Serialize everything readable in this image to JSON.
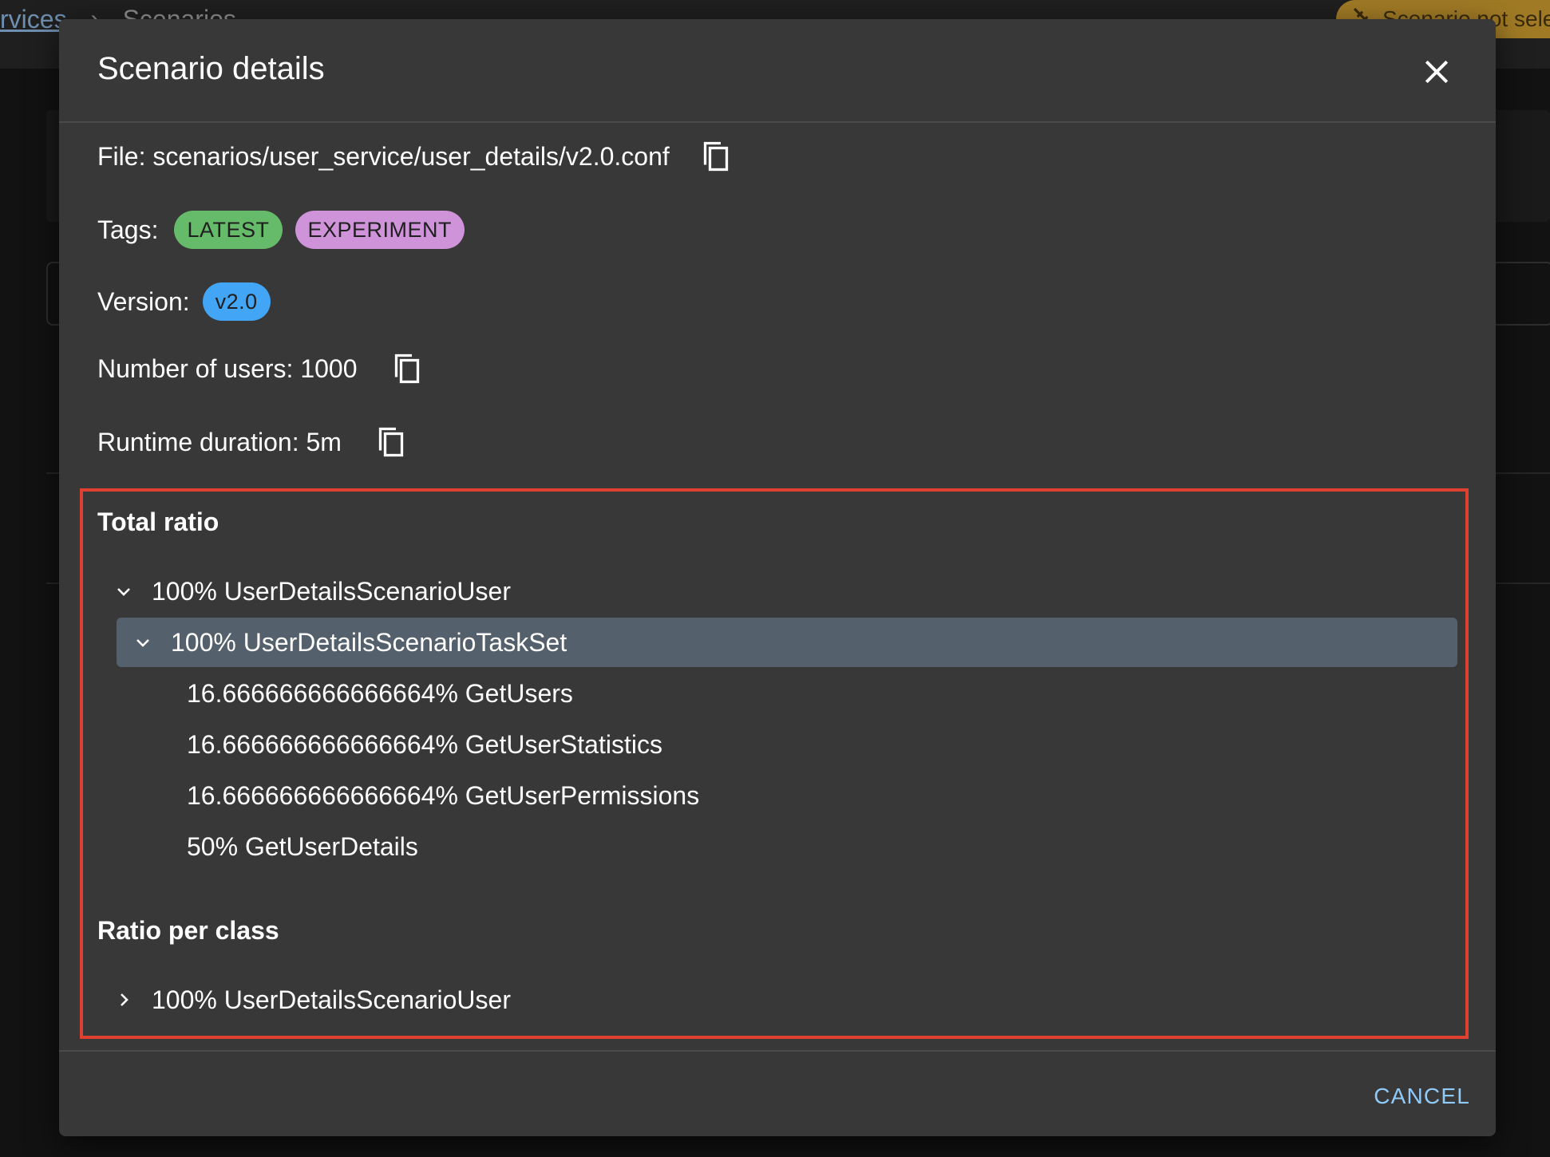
{
  "background": {
    "breadcrumb": [
      "rvices",
      "Scenarios"
    ],
    "status_text": "Scenario not selec"
  },
  "dialog": {
    "title": "Scenario details",
    "file_label": "File: scenarios/user_service/user_details/v2.0.conf",
    "tags_label": "Tags:",
    "tags": [
      {
        "label": "LATEST",
        "color": "#66bb6a"
      },
      {
        "label": "EXPERIMENT",
        "color": "#ce93d8"
      }
    ],
    "version_label": "Version:",
    "version": {
      "label": "v2.0",
      "color": "#42a5f5"
    },
    "users_label": "Number of users: 1000",
    "runtime_label": "Runtime duration: 5m",
    "total_ratio": {
      "title": "Total ratio",
      "user": "100% UserDetailsScenarioUser",
      "taskset": "100% UserDetailsScenarioTaskSet",
      "tasks": [
        "16.666666666666664% GetUsers",
        "16.666666666666664% GetUserStatistics",
        "16.666666666666664% GetUserPermissions",
        "50% GetUserDetails"
      ]
    },
    "ratio_per_class": {
      "title": "Ratio per class",
      "user": "100% UserDetailsScenarioUser"
    },
    "cancel_label": "CANCEL"
  },
  "colors": {
    "dialog_bg": "#383838",
    "selected_row": "#54606c",
    "highlight_border": "#e0402f",
    "accent": "#90caf9"
  }
}
